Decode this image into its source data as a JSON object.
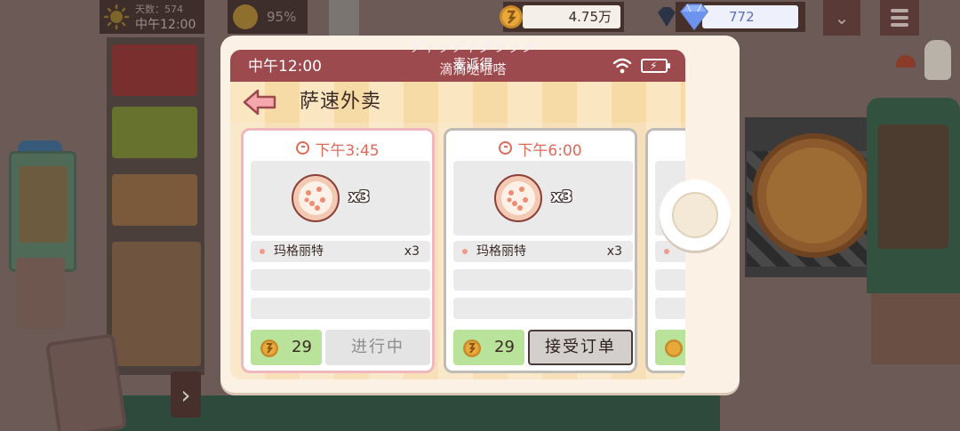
{
  "hud": {
    "day_count": "天数：574",
    "time": "中午12:00",
    "mood_percent": "95%",
    "coins": "4.75万",
    "gems": "772"
  },
  "phone": {
    "status_time": "中午12:00",
    "brand_line1": "麦派得",
    "brand_line2": "滴滴哒啦嗒",
    "watermark": "ディッディダラッタ",
    "header_title": "萨速外卖"
  },
  "orders": [
    {
      "time": "下午3:45",
      "pizza_qty": "x3",
      "item_name": "玛格丽特",
      "item_qty": "x3",
      "reward": "29",
      "status": "进行中"
    },
    {
      "time": "下午6:00",
      "pizza_qty": "x3",
      "item_name": "玛格丽特",
      "item_qty": "x3",
      "reward": "29",
      "action": "接受订单"
    }
  ],
  "colors": {
    "status_bar": "#9c4a4e",
    "accent_time": "#e06a58",
    "reward_badge": "#b9e39a",
    "active_card_border": "#f0b7bd"
  },
  "icons": [
    "sun-icon",
    "smile-face-icon",
    "coin-icon",
    "diamond-icon",
    "chevron-down-icon",
    "menu-icon",
    "wifi-icon",
    "battery-icon",
    "back-arrow-icon",
    "clock-icon",
    "pizza-icon"
  ]
}
